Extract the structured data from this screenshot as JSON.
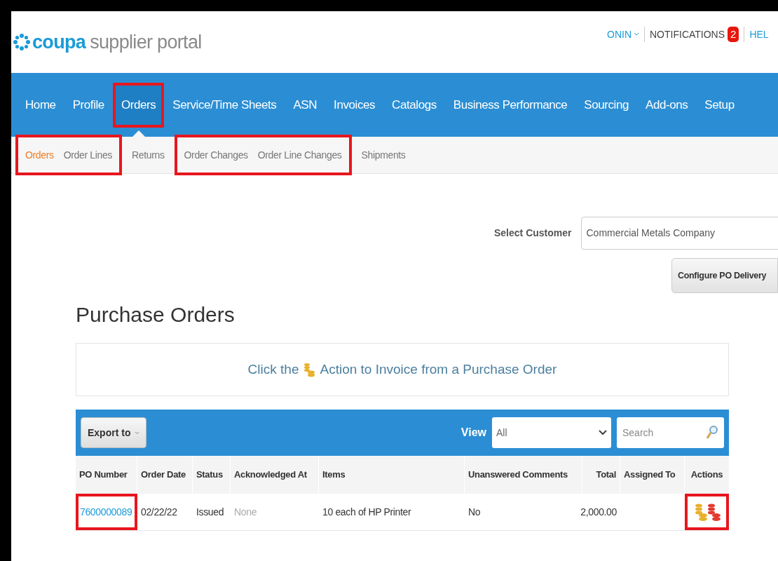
{
  "header": {
    "logo_word": "coupa",
    "logo_rest": "supplier portal",
    "user": "ONIN",
    "notifications": "NOTIFICATIONS",
    "notification_count": "2",
    "help": "HEL"
  },
  "nav": [
    {
      "label": "Home",
      "selected": false,
      "highlighted": false
    },
    {
      "label": "Profile",
      "selected": false,
      "highlighted": false
    },
    {
      "label": "Orders",
      "selected": true,
      "highlighted": true
    },
    {
      "label": "Service/Time Sheets",
      "selected": false,
      "highlighted": false
    },
    {
      "label": "ASN",
      "selected": false,
      "highlighted": false
    },
    {
      "label": "Invoices",
      "selected": false,
      "highlighted": false
    },
    {
      "label": "Catalogs",
      "selected": false,
      "highlighted": false
    },
    {
      "label": "Business Performance",
      "selected": false,
      "highlighted": false
    },
    {
      "label": "Sourcing",
      "selected": false,
      "highlighted": false
    },
    {
      "label": "Add-ons",
      "selected": false,
      "highlighted": false
    },
    {
      "label": "Setup",
      "selected": false,
      "highlighted": false
    }
  ],
  "subnav": [
    {
      "highlighted": true,
      "items": [
        {
          "label": "Orders",
          "selected": true
        },
        {
          "label": "Order Lines",
          "selected": false
        }
      ]
    },
    {
      "highlighted": false,
      "items": [
        {
          "label": "Returns",
          "selected": false
        }
      ]
    },
    {
      "highlighted": true,
      "items": [
        {
          "label": "Order Changes",
          "selected": false
        },
        {
          "label": "Order Line Changes",
          "selected": false
        }
      ]
    },
    {
      "highlighted": false,
      "items": [
        {
          "label": "Shipments",
          "selected": false
        }
      ]
    }
  ],
  "customer": {
    "label": "Select Customer",
    "value": "Commercial Metals Company"
  },
  "configure_button": "Configure PO Delivery",
  "title": "Purchase Orders",
  "info_banner": {
    "before": "Click the",
    "after": "Action to Invoice from a Purchase Order"
  },
  "toolbar": {
    "export": "Export to",
    "view_label": "View",
    "view_value": "All",
    "search_placeholder": "Search"
  },
  "table": {
    "columns": [
      "PO Number",
      "Order Date",
      "Status",
      "Acknowledged At",
      "Items",
      "Unanswered Comments",
      "Total",
      "Assigned To",
      "Actions"
    ],
    "rows": [
      {
        "cells": [
          {
            "kind": "link",
            "text": "7600000089",
            "highlighted": true
          },
          {
            "kind": "text",
            "text": "02/22/22",
            "highlighted": false
          },
          {
            "kind": "text",
            "text": "Issued",
            "highlighted": false
          },
          {
            "kind": "muted",
            "text": "None",
            "highlighted": false
          },
          {
            "kind": "text",
            "text": "10 each of HP Printer",
            "highlighted": false
          },
          {
            "kind": "text",
            "text": "No",
            "highlighted": false
          },
          {
            "kind": "text",
            "text": "2,000.00",
            "highlighted": false
          },
          {
            "kind": "empty",
            "highlighted": false
          },
          {
            "kind": "actions",
            "highlighted": true
          }
        ]
      }
    ]
  }
}
